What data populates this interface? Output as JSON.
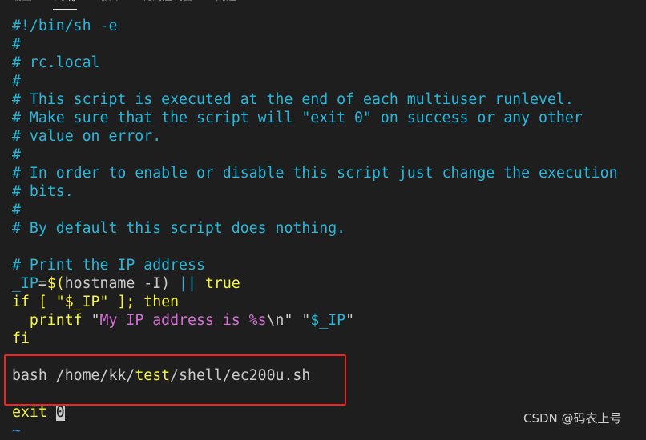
{
  "tabs": [
    {
      "label": "输出"
    },
    {
      "label": "终端",
      "active": true
    },
    {
      "label": "端口"
    },
    {
      "label": "调试控制台"
    },
    {
      "label": "问题"
    }
  ],
  "lines": [
    [
      {
        "t": "#!/bin/sh -e",
        "c": "c"
      }
    ],
    [
      {
        "t": "#",
        "c": "c"
      }
    ],
    [
      {
        "t": "# rc.local",
        "c": "c"
      }
    ],
    [
      {
        "t": "#",
        "c": "c"
      }
    ],
    [
      {
        "t": "# This script is executed at the end of each multiuser runlevel.",
        "c": "c"
      }
    ],
    [
      {
        "t": "# Make sure that the script will \"exit 0\" on success or any other",
        "c": "c"
      }
    ],
    [
      {
        "t": "# value on error.",
        "c": "c"
      }
    ],
    [
      {
        "t": "#",
        "c": "c"
      }
    ],
    [
      {
        "t": "# In order to enable or disable this script just change the execution",
        "c": "c"
      }
    ],
    [
      {
        "t": "# bits.",
        "c": "c"
      }
    ],
    [
      {
        "t": "#",
        "c": "c"
      }
    ],
    [
      {
        "t": "# By default this script does nothing.",
        "c": "c"
      }
    ],
    [],
    [
      {
        "t": "# Print the IP address",
        "c": "c"
      }
    ],
    [
      {
        "t": "_IP",
        "c": "c"
      },
      {
        "t": "=",
        "c": "w"
      },
      {
        "t": "$(",
        "c": "y"
      },
      {
        "t": "hostname -I",
        "c": "w"
      },
      {
        "t": ") ",
        "c": "w"
      },
      {
        "t": "|| ",
        "c": "c"
      },
      {
        "t": "true",
        "c": "y"
      }
    ],
    [
      {
        "t": "if [ ",
        "c": "y"
      },
      {
        "t": "\"$_IP\"",
        "c": "y"
      },
      {
        "t": " ]; then",
        "c": "y"
      }
    ],
    [
      {
        "t": "  printf ",
        "c": "y"
      },
      {
        "t": "\"",
        "c": "w"
      },
      {
        "t": "My IP address is %s",
        "c": "m"
      },
      {
        "t": "\\n",
        "c": "w"
      },
      {
        "t": "\" ",
        "c": "w"
      },
      {
        "t": "\"",
        "c": "w"
      },
      {
        "t": "$_IP",
        "c": "c"
      },
      {
        "t": "\"",
        "c": "w"
      }
    ],
    [
      {
        "t": "fi",
        "c": "y"
      }
    ],
    [],
    [
      {
        "t": "bash /home/kk/",
        "c": "w"
      },
      {
        "t": "test",
        "c": "y"
      },
      {
        "t": "/shell/ec200u.sh",
        "c": "w"
      }
    ],
    [],
    [
      {
        "t": "exit ",
        "c": "y"
      },
      {
        "t": "0",
        "c": "cur"
      }
    ],
    [
      {
        "t": "~",
        "c": "t"
      }
    ]
  ],
  "colors": {
    "background": "#1e1e1e",
    "comment": "#29b8db",
    "keyword": "#f5f543",
    "string": "#d670d6",
    "highlight_box": "#ff1e1e"
  },
  "watermark": "CSDN @码农上号"
}
